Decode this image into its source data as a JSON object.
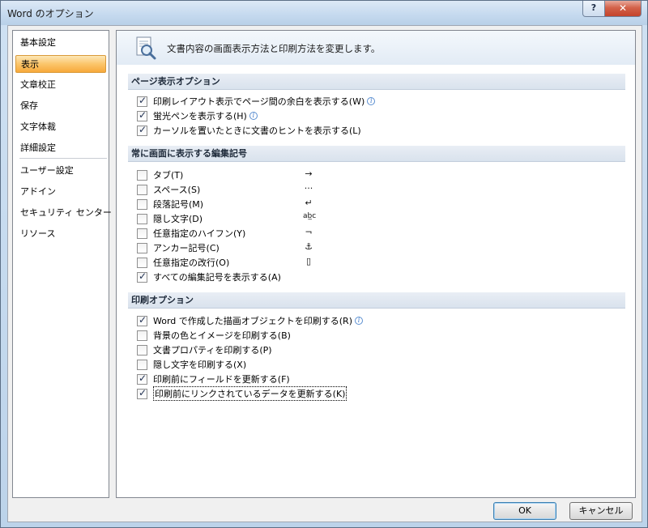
{
  "window": {
    "title": "Word のオプション",
    "help_label": "?",
    "close_label": "✕"
  },
  "sidebar": {
    "items": [
      {
        "label": "基本設定"
      },
      {
        "label": "表示"
      },
      {
        "label": "文章校正"
      },
      {
        "label": "保存"
      },
      {
        "label": "文字体裁"
      },
      {
        "label": "詳細設定"
      },
      {
        "label": "ユーザー設定"
      },
      {
        "label": "アドイン"
      },
      {
        "label": "セキュリティ センター"
      },
      {
        "label": "リソース"
      }
    ],
    "active_index": 1
  },
  "banner": {
    "text": "文書内容の画面表示方法と印刷方法を変更します。",
    "icon": "magnifier-document-icon"
  },
  "sections": {
    "page_display": {
      "title": "ページ表示オプション",
      "options": [
        {
          "label": "印刷レイアウト表示でページ間の余白を表示する(W)",
          "checked": true,
          "info": true
        },
        {
          "label": "蛍光ペンを表示する(H)",
          "checked": true,
          "info": true
        },
        {
          "label": "カーソルを置いたときに文書のヒントを表示する(L)",
          "checked": true,
          "info": false
        }
      ]
    },
    "marks": {
      "title": "常に画面に表示する編集記号",
      "options": [
        {
          "label": "タブ(T)",
          "checked": false,
          "symbol": "→"
        },
        {
          "label": "スペース(S)",
          "checked": false,
          "symbol": "···"
        },
        {
          "label": "段落記号(M)",
          "checked": false,
          "symbol": "↵"
        },
        {
          "label": "隠し文字(D)",
          "checked": false,
          "symbol": "ab̲c"
        },
        {
          "label": "任意指定のハイフン(Y)",
          "checked": false,
          "symbol": "¬"
        },
        {
          "label": "アンカー記号(C)",
          "checked": false,
          "symbol": "⚓"
        },
        {
          "label": "任意指定の改行(O)",
          "checked": false,
          "symbol": "▯"
        },
        {
          "label": "すべての編集記号を表示する(A)",
          "checked": true,
          "symbol": ""
        }
      ]
    },
    "print": {
      "title": "印刷オプション",
      "options": [
        {
          "label": "Word で作成した描画オブジェクトを印刷する(R)",
          "checked": true,
          "info": true
        },
        {
          "label": "背景の色とイメージを印刷する(B)",
          "checked": false,
          "info": false
        },
        {
          "label": "文書プロパティを印刷する(P)",
          "checked": false,
          "info": false
        },
        {
          "label": "隠し文字を印刷する(X)",
          "checked": false,
          "info": false
        },
        {
          "label": "印刷前にフィールドを更新する(F)",
          "checked": true,
          "info": false
        },
        {
          "label": "印刷前にリンクされているデータを更新する(K)",
          "checked": true,
          "info": false,
          "focused": true
        }
      ]
    }
  },
  "footer": {
    "ok_label": "OK",
    "cancel_label": "キャンセル"
  },
  "colors": {
    "active_nav": "#fbc56b",
    "checkmark": "#1f2f52",
    "section_header": "#d9e2ed"
  }
}
